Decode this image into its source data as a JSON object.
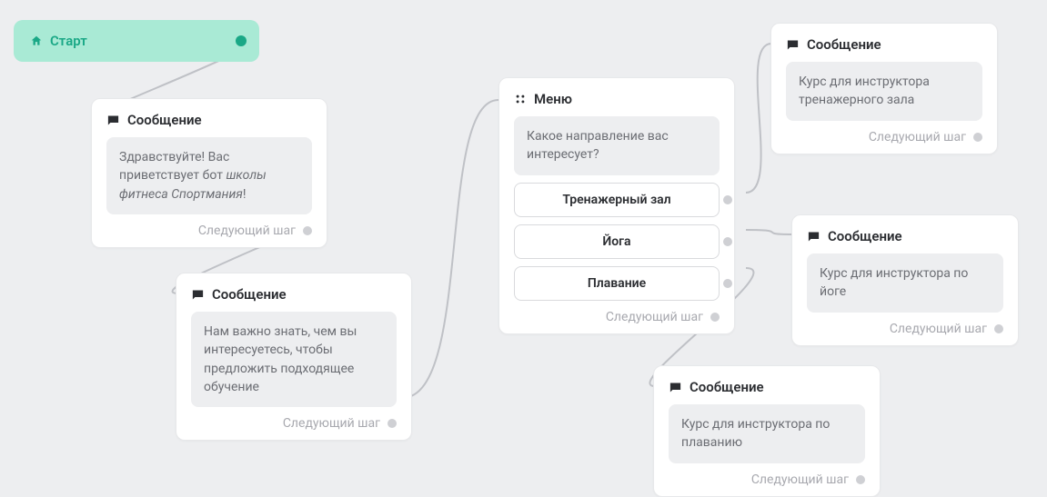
{
  "start": {
    "label": "Старт"
  },
  "msg1": {
    "title": "Сообщение",
    "text_pre": "Здравствуйте! Вас приветствует бот ",
    "text_em": "школы фитнеса Спортмания",
    "text_post": "!",
    "next": "Следующий шаг"
  },
  "msg2": {
    "title": "Сообщение",
    "text": "Нам важно знать, чем вы интересуетесь, чтобы предложить подходящее обучение",
    "next": "Следующий шаг"
  },
  "menu": {
    "title": "Меню",
    "prompt": "Какое направление вас интересует?",
    "options": [
      "Тренажерный зал",
      "Йога",
      "Плавание"
    ],
    "next": "Следующий шаг"
  },
  "out_gym": {
    "title": "Сообщение",
    "text": "Курс для инструктора тренажерного зала",
    "next": "Следующий шаг"
  },
  "out_yoga": {
    "title": "Сообщение",
    "text": "Курс для инструктора по йоге",
    "next": "Следующий шаг"
  },
  "out_swim": {
    "title": "Сообщение",
    "text": "Курс для инструктора по плаванию",
    "next": "Следующий шаг"
  }
}
